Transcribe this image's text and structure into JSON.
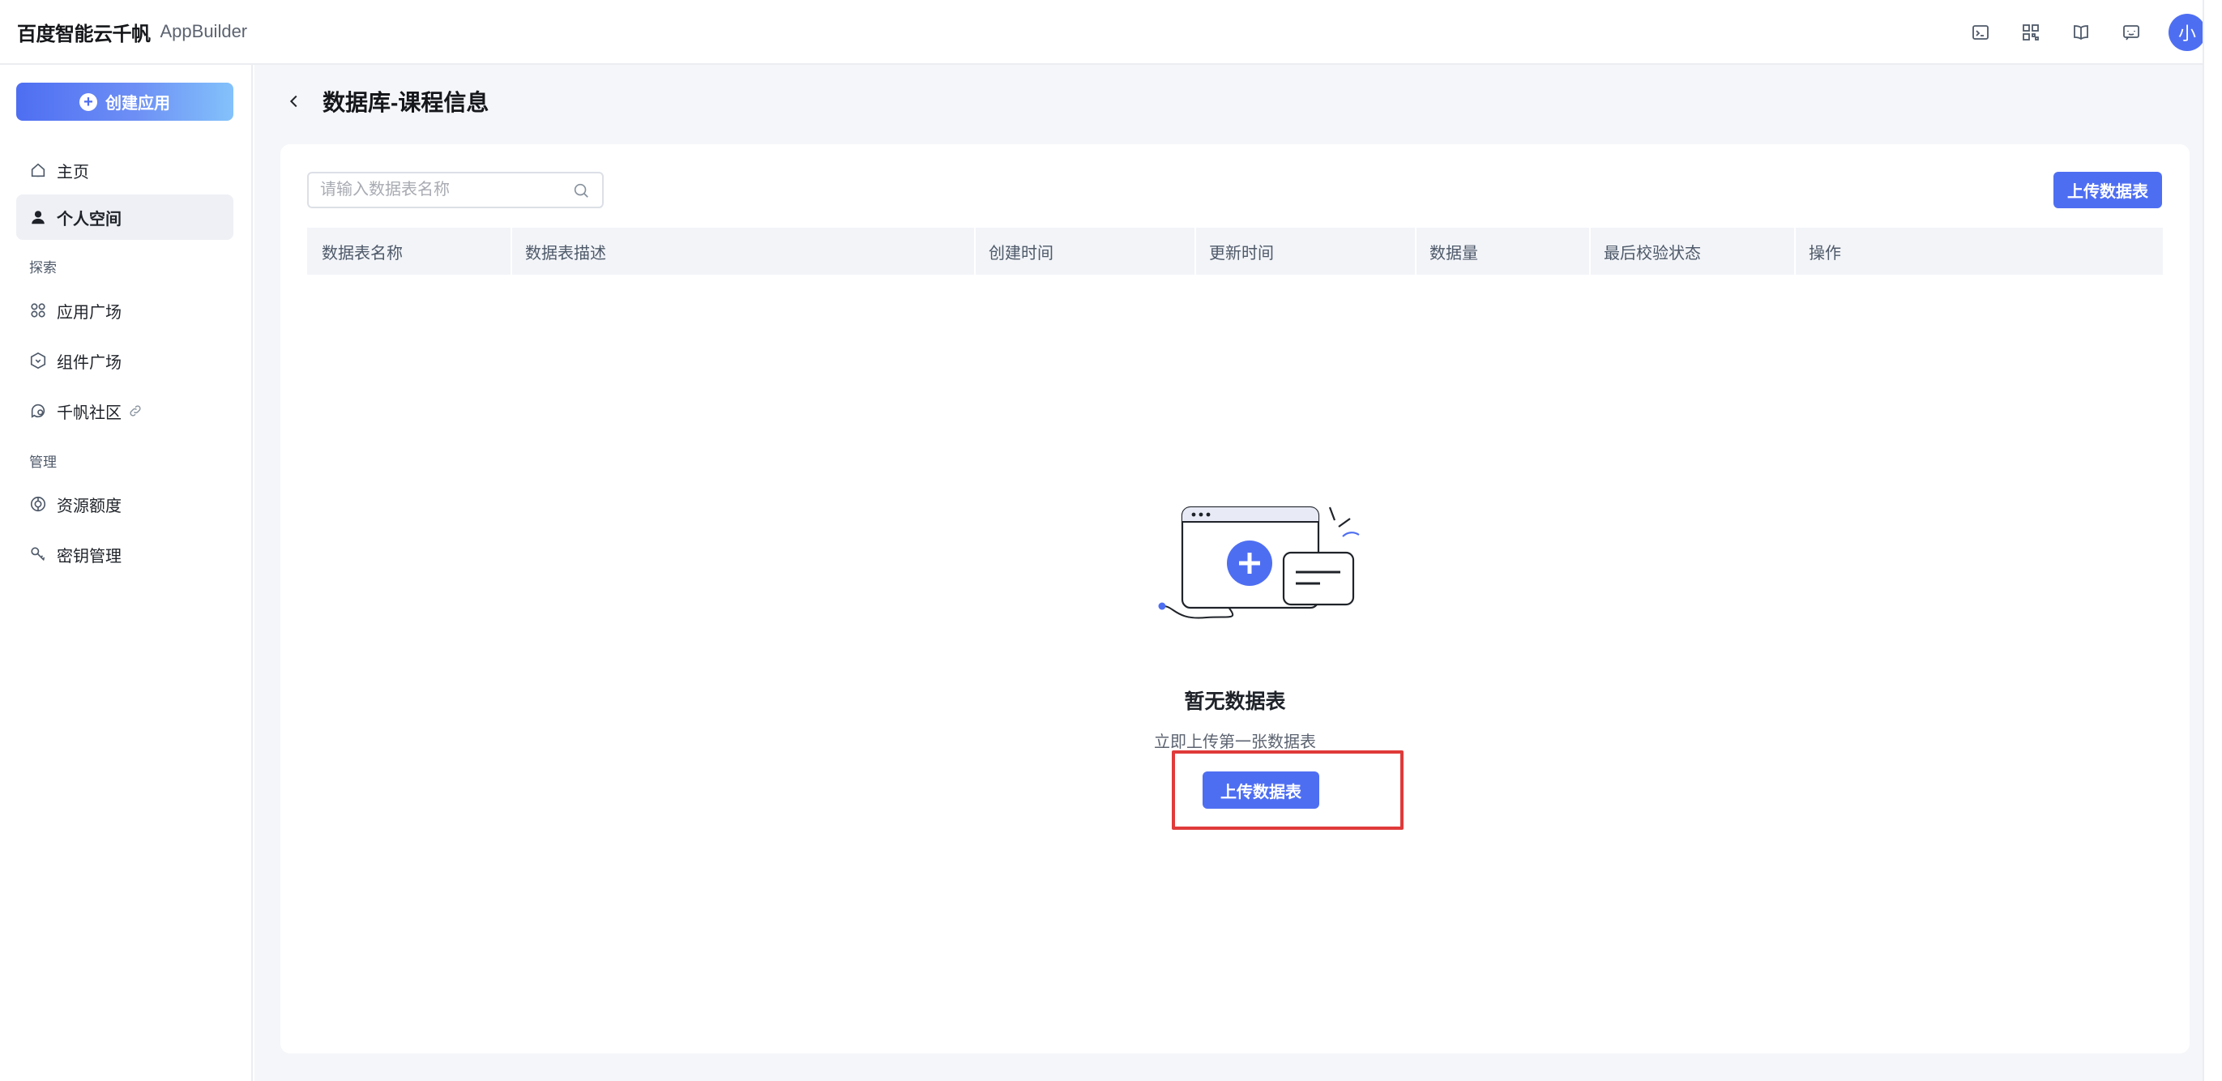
{
  "brand": {
    "logo": "百度智能云千帆",
    "app": "AppBuilder"
  },
  "top_icons": [
    "terminal-icon",
    "qrcode-icon",
    "book-icon",
    "message-icon"
  ],
  "user": {
    "avatar_text": "小"
  },
  "sidebar": {
    "create_label": "创建应用",
    "items": [
      {
        "label": "主页",
        "icon": "home-icon",
        "active": false
      },
      {
        "label": "个人空间",
        "icon": "user-icon",
        "active": true
      }
    ],
    "section_explore": "探索",
    "explore_items": [
      {
        "label": "应用广场",
        "icon": "apps-icon"
      },
      {
        "label": "组件广场",
        "icon": "component-icon"
      },
      {
        "label": "千帆社区",
        "icon": "community-icon",
        "external": true
      }
    ],
    "section_manage": "管理",
    "manage_items": [
      {
        "label": "资源额度",
        "icon": "quota-icon"
      },
      {
        "label": "密钥管理",
        "icon": "key-icon"
      }
    ]
  },
  "page": {
    "title": "数据库-课程信息"
  },
  "search": {
    "placeholder": "请输入数据表名称",
    "value": ""
  },
  "toolbar": {
    "upload_label": "上传数据表"
  },
  "table": {
    "columns": [
      "数据表名称",
      "数据表描述",
      "创建时间",
      "更新时间",
      "数据量",
      "最后校验状态",
      "操作"
    ],
    "rows": []
  },
  "empty_state": {
    "title": "暂无数据表",
    "subtitle": "立即上传第一张数据表",
    "button_label": "上传数据表"
  },
  "colors": {
    "primary": "#4e6ef2",
    "highlight": "#e03a3a",
    "background": "#f5f6f9"
  }
}
